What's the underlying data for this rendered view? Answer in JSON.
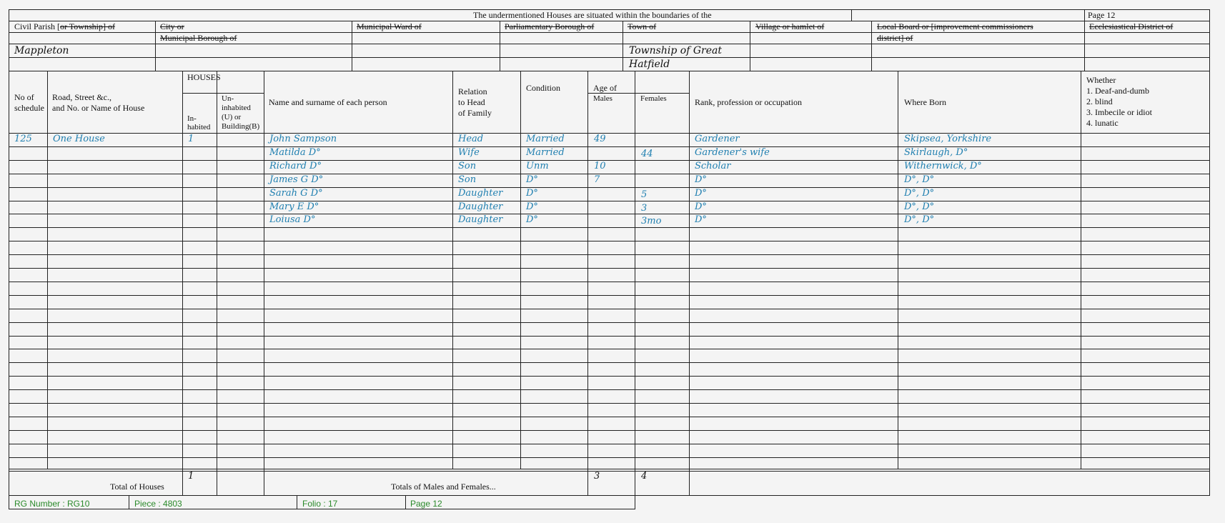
{
  "header": {
    "title": "The undermentioned Houses are situated within the boundaries of the",
    "page_label": "Page  12",
    "cols": [
      {
        "lines": [
          {
            "text": "Civil Parish [",
            "strike": false
          },
          {
            "text": "or Township] of",
            "strike": true
          }
        ]
      },
      {
        "lines": [
          {
            "text": "City or",
            "strike": true
          }
        ],
        "line2": "Municipal Borough of"
      },
      {
        "lines": [
          {
            "text": "Municipal Ward of",
            "strike": true
          }
        ]
      },
      {
        "lines": [
          {
            "text": "Parliamentary Borough of",
            "strike": true
          }
        ]
      },
      {
        "lines": [
          {
            "text": "Town of",
            "strike": true
          }
        ]
      },
      {
        "lines": [
          {
            "text": "Village or hamlet of",
            "strike": true
          }
        ]
      },
      {
        "lines": [
          {
            "text": "Local Board or [improvement commissioners",
            "strike": true
          }
        ],
        "line2": "district] of"
      },
      {
        "lines": [
          {
            "text": "Ecclesiastical District of",
            "strike": true
          }
        ]
      }
    ],
    "values": {
      "civil_parish": "Mappleton",
      "town_line1": "Township of Great",
      "town_line2": "Hatfield"
    }
  },
  "columns": {
    "schedule": [
      "No of",
      "schedule"
    ],
    "road": [
      "Road, Street &c.,",
      "and No. or Name of House"
    ],
    "houses": "HOUSES",
    "inhabited": [
      "In-",
      "habited"
    ],
    "uninhabited": [
      "Un-",
      "inhabited",
      "(U) or",
      "Building(B)"
    ],
    "name": "Name and surname of each person",
    "relation": [
      "Relation",
      "to Head",
      "of Family"
    ],
    "condition": "Condition",
    "age_of": "Age of",
    "males": "Males",
    "females": "Females",
    "occupation": "Rank, profession or occupation",
    "where_born": "Where Born",
    "whether": [
      "Whether",
      "1. Deaf-and-dumb",
      "2. blind",
      "3. Imbecile or idiot",
      "4. lunatic"
    ]
  },
  "rows": [
    {
      "schedule": "125",
      "road": "One House",
      "inhabited": "1",
      "name": "John Sampson",
      "relation": "Head",
      "condition": "Married",
      "males": "49",
      "females": "",
      "occupation": "Gardener",
      "born": "Skipsea, Yorkshire"
    },
    {
      "schedule": "",
      "road": "",
      "inhabited": "",
      "name": "Matilda D°",
      "relation": "Wife",
      "condition": "Married",
      "males": "",
      "females": "44",
      "occupation": "Gardener's wife",
      "born": "Skirlaugh, D°"
    },
    {
      "schedule": "",
      "road": "",
      "inhabited": "",
      "name": "Richard D°",
      "relation": "Son",
      "condition": "Unm",
      "males": "10",
      "females": "",
      "occupation": "Scholar",
      "born": "Withernwick, D°"
    },
    {
      "schedule": "",
      "road": "",
      "inhabited": "",
      "name": "James G D°",
      "relation": "Son",
      "condition": "D°",
      "males": "7",
      "females": "",
      "occupation": "D°",
      "born": "D°, D°"
    },
    {
      "schedule": "",
      "road": "",
      "inhabited": "",
      "name": "Sarah G D°",
      "relation": "Daughter",
      "condition": "D°",
      "males": "",
      "females": "5",
      "occupation": "D°",
      "born": "D°, D°"
    },
    {
      "schedule": "",
      "road": "",
      "inhabited": "",
      "name": "Mary E D°",
      "relation": "Daughter",
      "condition": "D°",
      "males": "",
      "females": "3",
      "occupation": "D°",
      "born": "D°, D°"
    },
    {
      "schedule": "",
      "road": "",
      "inhabited": "",
      "name": "Loiusa D°",
      "relation": "Daughter",
      "condition": "D°",
      "males": "",
      "females": "3mo",
      "occupation": "D°",
      "born": "D°, D°"
    }
  ],
  "totals": {
    "houses_label": "Total of Houses",
    "houses_value": "1",
    "persons_label": "Totals of Males and Females...",
    "males_total": "3",
    "females_total": "4"
  },
  "footer": {
    "rg": "RG Number : RG10",
    "piece": "Piece : 4803",
    "folio": "Folio : 17",
    "page": "Page 12"
  }
}
